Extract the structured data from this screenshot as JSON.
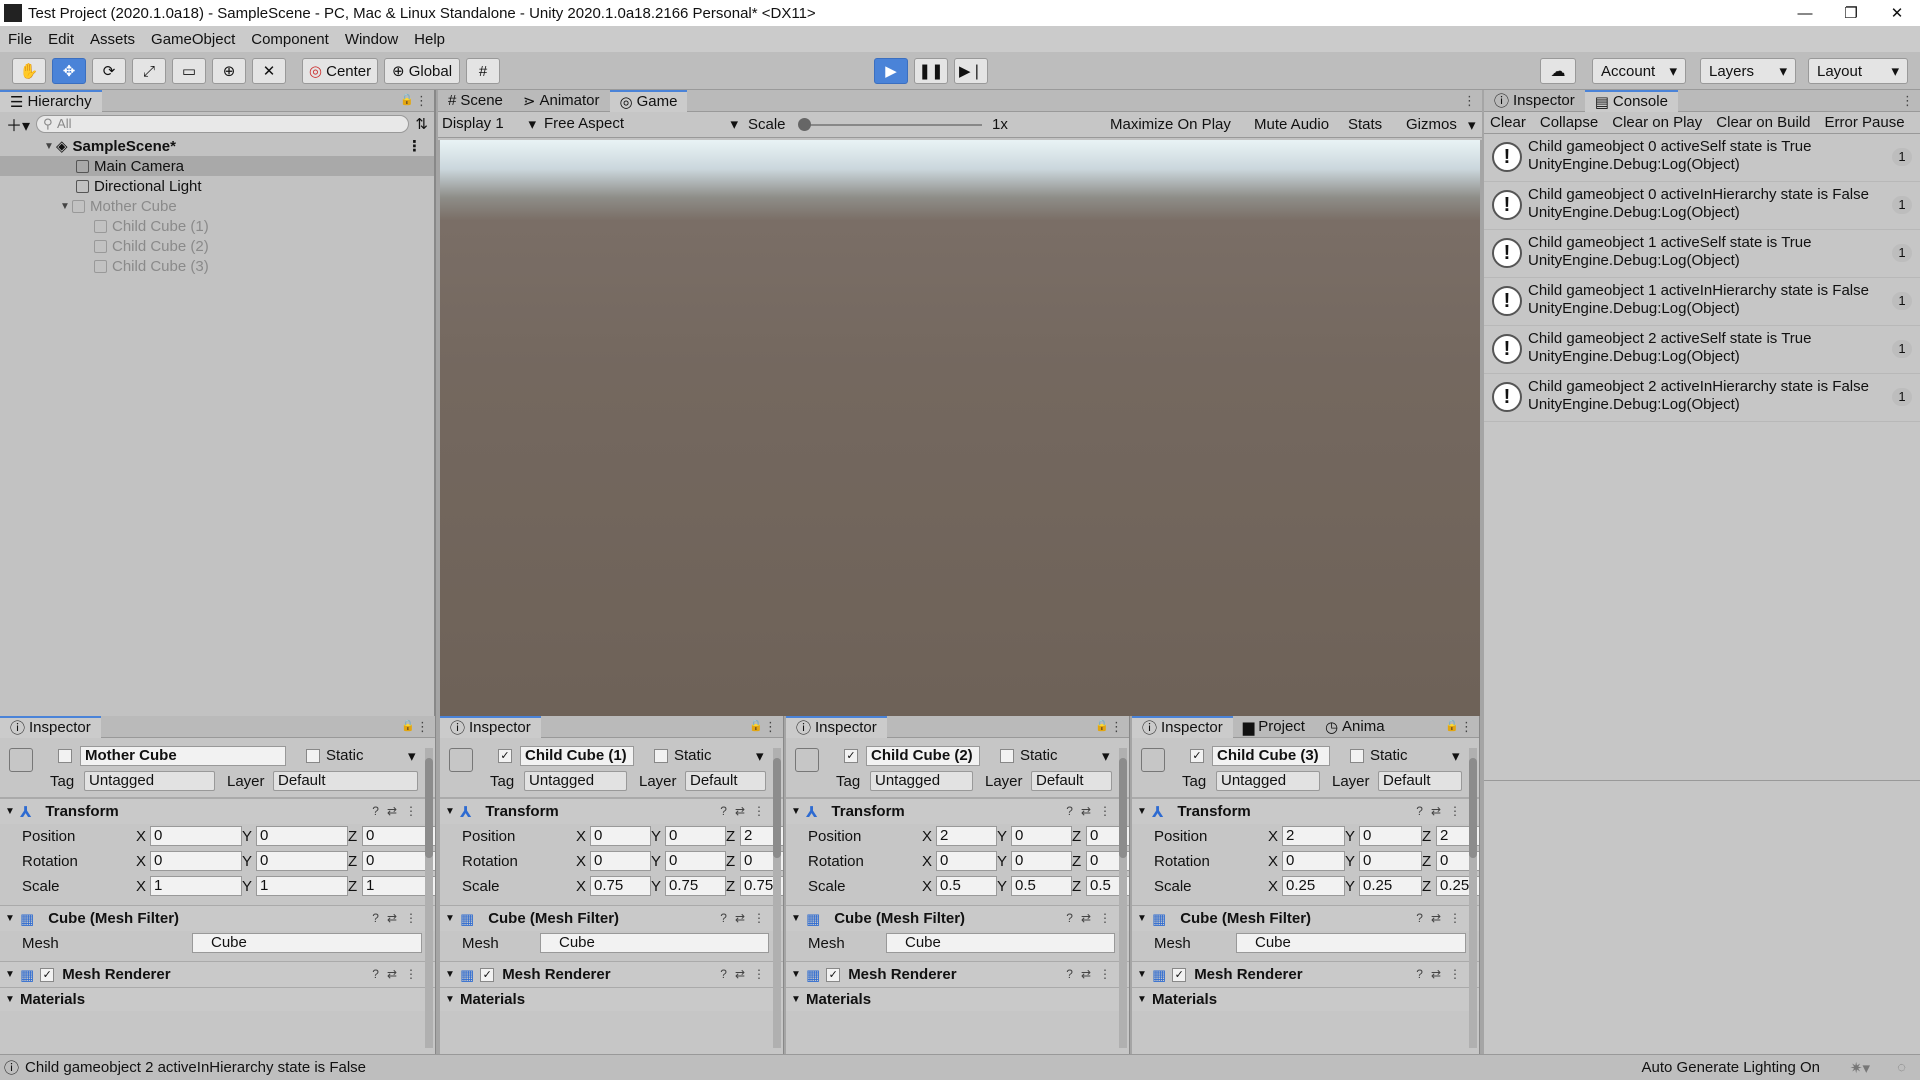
{
  "window": {
    "title": "Test Project (2020.1.0a18) - SampleScene - PC, Mac & Linux Standalone - Unity 2020.1.0a18.2166 Personal* <DX11>"
  },
  "menu": [
    "File",
    "Edit",
    "Assets",
    "GameObject",
    "Component",
    "Window",
    "Help"
  ],
  "toolbar": {
    "center_label": "Center",
    "global_label": "Global",
    "account_label": "Account",
    "layers_label": "Layers",
    "layout_label": "Layout"
  },
  "hierarchy": {
    "tab": "Hierarchy",
    "search_placeholder": "All",
    "scene": "SampleScene*",
    "items": [
      {
        "label": "Main Camera"
      },
      {
        "label": "Directional Light"
      },
      {
        "label": "Mother Cube"
      },
      {
        "label": "Child Cube (1)"
      },
      {
        "label": "Child Cube (2)"
      },
      {
        "label": "Child Cube (3)"
      }
    ]
  },
  "center_tabs": [
    "Scene",
    "Animator",
    "Game"
  ],
  "game_toolbar": {
    "display": "Display 1",
    "aspect": "Free Aspect",
    "scale_label": "Scale",
    "scale_value": "1x",
    "maximize": "Maximize On Play",
    "mute": "Mute Audio",
    "stats": "Stats",
    "gizmos": "Gizmos"
  },
  "right_tabs": [
    "Inspector",
    "Console"
  ],
  "console_toolbar": [
    "Clear",
    "Collapse",
    "Clear on Play",
    "Clear on Build",
    "Error Pause"
  ],
  "console_logs": [
    {
      "line1": "Child gameobject 0 activeSelf state is True",
      "line2": "UnityEngine.Debug:Log(Object)",
      "count": "1"
    },
    {
      "line1": "Child gameobject 0 activeInHierarchy state is False",
      "line2": "UnityEngine.Debug:Log(Object)",
      "count": "1"
    },
    {
      "line1": "Child gameobject 1 activeSelf state is True",
      "line2": "UnityEngine.Debug:Log(Object)",
      "count": "1"
    },
    {
      "line1": "Child gameobject 1 activeInHierarchy state is False",
      "line2": "UnityEngine.Debug:Log(Object)",
      "count": "1"
    },
    {
      "line1": "Child gameobject 2 activeSelf state is True",
      "line2": "UnityEngine.Debug:Log(Object)",
      "count": "1"
    },
    {
      "line1": "Child gameobject 2 activeInHierarchy state is False",
      "line2": "UnityEngine.Debug:Log(Object)",
      "count": "1"
    }
  ],
  "common": {
    "inspector": "Inspector",
    "project": "Project",
    "anim": "Anima",
    "static": "Static",
    "tag": "Tag",
    "untagged": "Untagged",
    "layer": "Layer",
    "default": "Default",
    "transform": "Transform",
    "position": "Position",
    "rotation": "Rotation",
    "scale": "Scale",
    "x": "X",
    "y": "Y",
    "z": "Z",
    "mesh_filter": "Cube (Mesh Filter)",
    "mesh": "Mesh",
    "mesh_value": "Cube",
    "mesh_renderer": "Mesh Renderer",
    "materials": "Materials"
  },
  "inspectors": [
    {
      "name": "Mother Cube",
      "pos": [
        "0",
        "0",
        "0"
      ],
      "rot": [
        "0",
        "0",
        "0"
      ],
      "scl": [
        "1",
        "1",
        "1"
      ]
    },
    {
      "name": "Child Cube (1)",
      "pos": [
        "0",
        "0",
        "2"
      ],
      "rot": [
        "0",
        "0",
        "0"
      ],
      "scl": [
        "0.75",
        "0.75",
        "0.75"
      ]
    },
    {
      "name": "Child Cube (2)",
      "pos": [
        "2",
        "0",
        "0"
      ],
      "rot": [
        "0",
        "0",
        "0"
      ],
      "scl": [
        "0.5",
        "0.5",
        "0.5"
      ]
    },
    {
      "name": "Child Cube (3)",
      "pos": [
        "2",
        "0",
        "2"
      ],
      "rot": [
        "0",
        "0",
        "0"
      ],
      "scl": [
        "0.25",
        "0.25",
        "0.25"
      ]
    }
  ],
  "status": {
    "message": "Child gameobject 2 activeInHierarchy state is False",
    "lighting": "Auto Generate Lighting On"
  }
}
